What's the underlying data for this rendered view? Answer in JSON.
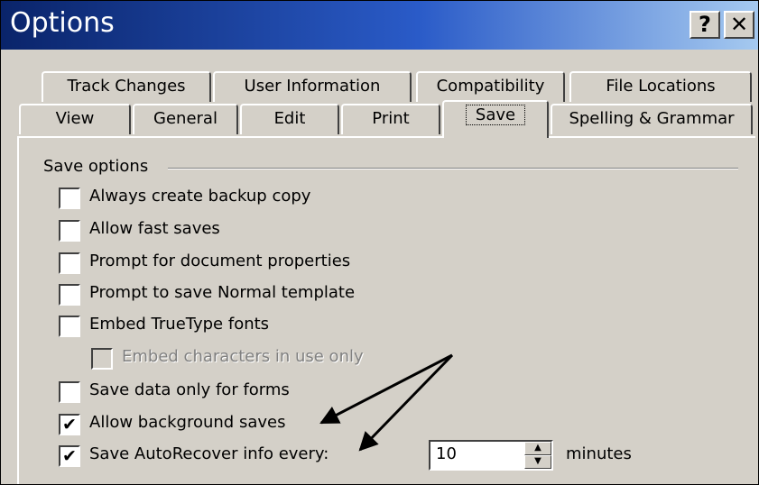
{
  "window": {
    "title": "Options",
    "help_glyph": "?",
    "close_glyph": "✕"
  },
  "tabs_back": [
    "Track Changes",
    "User Information",
    "Compatibility",
    "File Locations"
  ],
  "tabs_front": [
    "View",
    "General",
    "Edit",
    "Print",
    "Save",
    "Spelling & Grammar"
  ],
  "active_tab": "Save",
  "group": {
    "label": "Save options"
  },
  "options": [
    {
      "label": "Always create backup copy",
      "checked": false,
      "enabled": true
    },
    {
      "label": "Allow fast saves",
      "checked": false,
      "enabled": true
    },
    {
      "label": "Prompt for document properties",
      "checked": false,
      "enabled": true
    },
    {
      "label": "Prompt to save Normal template",
      "checked": false,
      "enabled": true
    },
    {
      "label": "Embed TrueType fonts",
      "checked": false,
      "enabled": true
    },
    {
      "label": "Embed characters in use only",
      "checked": false,
      "enabled": false
    },
    {
      "label": "Save data only for forms",
      "checked": false,
      "enabled": true
    },
    {
      "label": "Allow background saves",
      "checked": true,
      "enabled": true
    },
    {
      "label": "Save AutoRecover info every:",
      "checked": true,
      "enabled": true
    }
  ],
  "autorecover": {
    "value": "10",
    "unit": "minutes"
  },
  "icons": {
    "check": "checkmark-icon",
    "spin_up": "spin-up-icon",
    "spin_down": "spin-down-icon"
  }
}
